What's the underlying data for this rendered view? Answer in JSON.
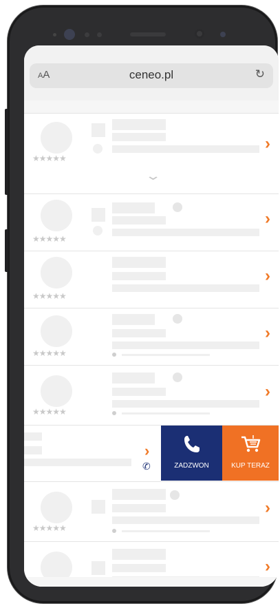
{
  "browser": {
    "text_size_label": "AA",
    "url": "ceneo.pl",
    "reload_icon": "reload-icon"
  },
  "placeholder_rating": "★★★★★",
  "actions": {
    "call_label": "ZADZWON",
    "buy_label": "KUP TERAZ",
    "call_color": "#1b2f74",
    "buy_color": "#f07124"
  },
  "colors": {
    "accent": "#f07a28",
    "skeleton": "#efefef"
  }
}
